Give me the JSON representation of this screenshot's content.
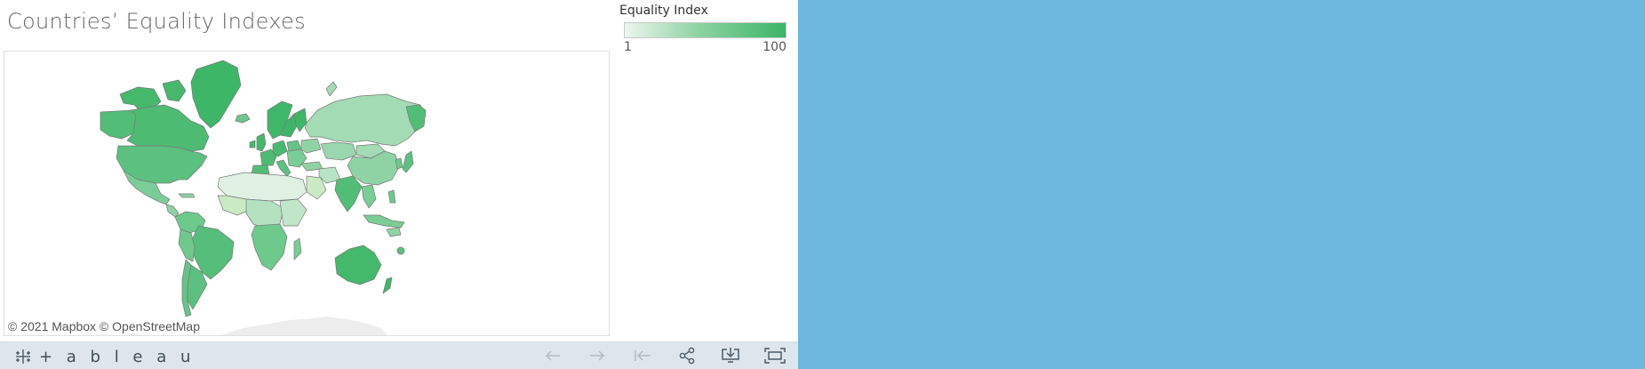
{
  "title": "Countries’ Equality Indexes",
  "legend": {
    "title": "Equality Index",
    "min_label": "1",
    "max_label": "100",
    "color_low": "#ecf6ef",
    "color_high": "#3bb566"
  },
  "map": {
    "attribution": "© 2021 Mapbox  © OpenStreetMap",
    "border_color": "#7a7a7a"
  },
  "toolbar": {
    "logo_text": "+ a b l e a u",
    "buttons": [
      {
        "name": "undo-button",
        "icon": "arrow-left-icon",
        "enabled": false
      },
      {
        "name": "redo-button",
        "icon": "arrow-right-icon",
        "enabled": false
      },
      {
        "name": "revert-button",
        "icon": "revert-icon",
        "enabled": false
      },
      {
        "name": "share-button",
        "icon": "share-icon",
        "enabled": true
      },
      {
        "name": "download-button",
        "icon": "download-icon",
        "enabled": true
      },
      {
        "name": "fullscreen-button",
        "icon": "fullscreen-icon",
        "enabled": true
      }
    ]
  },
  "background_color": "#6BB7DD"
}
